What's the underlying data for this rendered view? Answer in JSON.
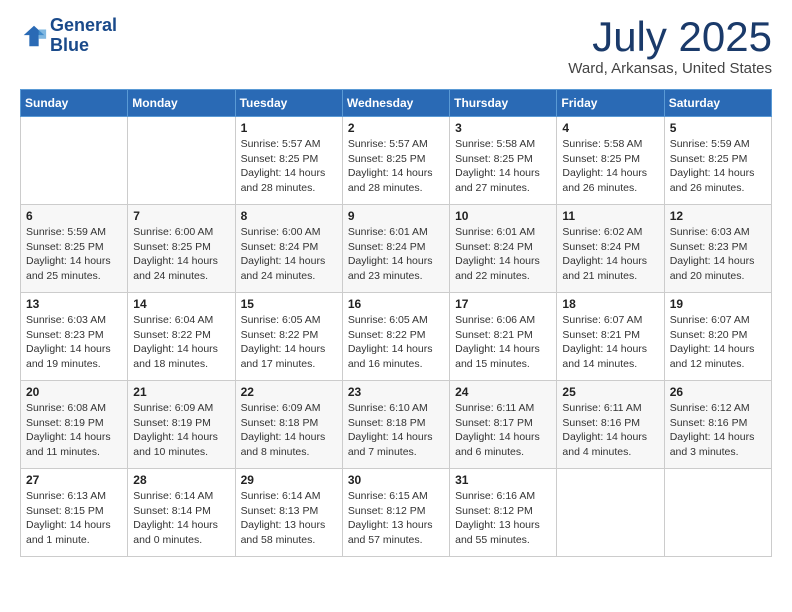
{
  "header": {
    "logo_line1": "General",
    "logo_line2": "Blue",
    "month": "July 2025",
    "location": "Ward, Arkansas, United States"
  },
  "weekdays": [
    "Sunday",
    "Monday",
    "Tuesday",
    "Wednesday",
    "Thursday",
    "Friday",
    "Saturday"
  ],
  "weeks": [
    [
      {
        "day": "",
        "info": ""
      },
      {
        "day": "",
        "info": ""
      },
      {
        "day": "1",
        "sunrise": "Sunrise: 5:57 AM",
        "sunset": "Sunset: 8:25 PM",
        "daylight": "Daylight: 14 hours and 28 minutes."
      },
      {
        "day": "2",
        "sunrise": "Sunrise: 5:57 AM",
        "sunset": "Sunset: 8:25 PM",
        "daylight": "Daylight: 14 hours and 28 minutes."
      },
      {
        "day": "3",
        "sunrise": "Sunrise: 5:58 AM",
        "sunset": "Sunset: 8:25 PM",
        "daylight": "Daylight: 14 hours and 27 minutes."
      },
      {
        "day": "4",
        "sunrise": "Sunrise: 5:58 AM",
        "sunset": "Sunset: 8:25 PM",
        "daylight": "Daylight: 14 hours and 26 minutes."
      },
      {
        "day": "5",
        "sunrise": "Sunrise: 5:59 AM",
        "sunset": "Sunset: 8:25 PM",
        "daylight": "Daylight: 14 hours and 26 minutes."
      }
    ],
    [
      {
        "day": "6",
        "sunrise": "Sunrise: 5:59 AM",
        "sunset": "Sunset: 8:25 PM",
        "daylight": "Daylight: 14 hours and 25 minutes."
      },
      {
        "day": "7",
        "sunrise": "Sunrise: 6:00 AM",
        "sunset": "Sunset: 8:25 PM",
        "daylight": "Daylight: 14 hours and 24 minutes."
      },
      {
        "day": "8",
        "sunrise": "Sunrise: 6:00 AM",
        "sunset": "Sunset: 8:24 PM",
        "daylight": "Daylight: 14 hours and 24 minutes."
      },
      {
        "day": "9",
        "sunrise": "Sunrise: 6:01 AM",
        "sunset": "Sunset: 8:24 PM",
        "daylight": "Daylight: 14 hours and 23 minutes."
      },
      {
        "day": "10",
        "sunrise": "Sunrise: 6:01 AM",
        "sunset": "Sunset: 8:24 PM",
        "daylight": "Daylight: 14 hours and 22 minutes."
      },
      {
        "day": "11",
        "sunrise": "Sunrise: 6:02 AM",
        "sunset": "Sunset: 8:24 PM",
        "daylight": "Daylight: 14 hours and 21 minutes."
      },
      {
        "day": "12",
        "sunrise": "Sunrise: 6:03 AM",
        "sunset": "Sunset: 8:23 PM",
        "daylight": "Daylight: 14 hours and 20 minutes."
      }
    ],
    [
      {
        "day": "13",
        "sunrise": "Sunrise: 6:03 AM",
        "sunset": "Sunset: 8:23 PM",
        "daylight": "Daylight: 14 hours and 19 minutes."
      },
      {
        "day": "14",
        "sunrise": "Sunrise: 6:04 AM",
        "sunset": "Sunset: 8:22 PM",
        "daylight": "Daylight: 14 hours and 18 minutes."
      },
      {
        "day": "15",
        "sunrise": "Sunrise: 6:05 AM",
        "sunset": "Sunset: 8:22 PM",
        "daylight": "Daylight: 14 hours and 17 minutes."
      },
      {
        "day": "16",
        "sunrise": "Sunrise: 6:05 AM",
        "sunset": "Sunset: 8:22 PM",
        "daylight": "Daylight: 14 hours and 16 minutes."
      },
      {
        "day": "17",
        "sunrise": "Sunrise: 6:06 AM",
        "sunset": "Sunset: 8:21 PM",
        "daylight": "Daylight: 14 hours and 15 minutes."
      },
      {
        "day": "18",
        "sunrise": "Sunrise: 6:07 AM",
        "sunset": "Sunset: 8:21 PM",
        "daylight": "Daylight: 14 hours and 14 minutes."
      },
      {
        "day": "19",
        "sunrise": "Sunrise: 6:07 AM",
        "sunset": "Sunset: 8:20 PM",
        "daylight": "Daylight: 14 hours and 12 minutes."
      }
    ],
    [
      {
        "day": "20",
        "sunrise": "Sunrise: 6:08 AM",
        "sunset": "Sunset: 8:19 PM",
        "daylight": "Daylight: 14 hours and 11 minutes."
      },
      {
        "day": "21",
        "sunrise": "Sunrise: 6:09 AM",
        "sunset": "Sunset: 8:19 PM",
        "daylight": "Daylight: 14 hours and 10 minutes."
      },
      {
        "day": "22",
        "sunrise": "Sunrise: 6:09 AM",
        "sunset": "Sunset: 8:18 PM",
        "daylight": "Daylight: 14 hours and 8 minutes."
      },
      {
        "day": "23",
        "sunrise": "Sunrise: 6:10 AM",
        "sunset": "Sunset: 8:18 PM",
        "daylight": "Daylight: 14 hours and 7 minutes."
      },
      {
        "day": "24",
        "sunrise": "Sunrise: 6:11 AM",
        "sunset": "Sunset: 8:17 PM",
        "daylight": "Daylight: 14 hours and 6 minutes."
      },
      {
        "day": "25",
        "sunrise": "Sunrise: 6:11 AM",
        "sunset": "Sunset: 8:16 PM",
        "daylight": "Daylight: 14 hours and 4 minutes."
      },
      {
        "day": "26",
        "sunrise": "Sunrise: 6:12 AM",
        "sunset": "Sunset: 8:16 PM",
        "daylight": "Daylight: 14 hours and 3 minutes."
      }
    ],
    [
      {
        "day": "27",
        "sunrise": "Sunrise: 6:13 AM",
        "sunset": "Sunset: 8:15 PM",
        "daylight": "Daylight: 14 hours and 1 minute."
      },
      {
        "day": "28",
        "sunrise": "Sunrise: 6:14 AM",
        "sunset": "Sunset: 8:14 PM",
        "daylight": "Daylight: 14 hours and 0 minutes."
      },
      {
        "day": "29",
        "sunrise": "Sunrise: 6:14 AM",
        "sunset": "Sunset: 8:13 PM",
        "daylight": "Daylight: 13 hours and 58 minutes."
      },
      {
        "day": "30",
        "sunrise": "Sunrise: 6:15 AM",
        "sunset": "Sunset: 8:12 PM",
        "daylight": "Daylight: 13 hours and 57 minutes."
      },
      {
        "day": "31",
        "sunrise": "Sunrise: 6:16 AM",
        "sunset": "Sunset: 8:12 PM",
        "daylight": "Daylight: 13 hours and 55 minutes."
      },
      {
        "day": "",
        "info": ""
      },
      {
        "day": "",
        "info": ""
      }
    ]
  ]
}
